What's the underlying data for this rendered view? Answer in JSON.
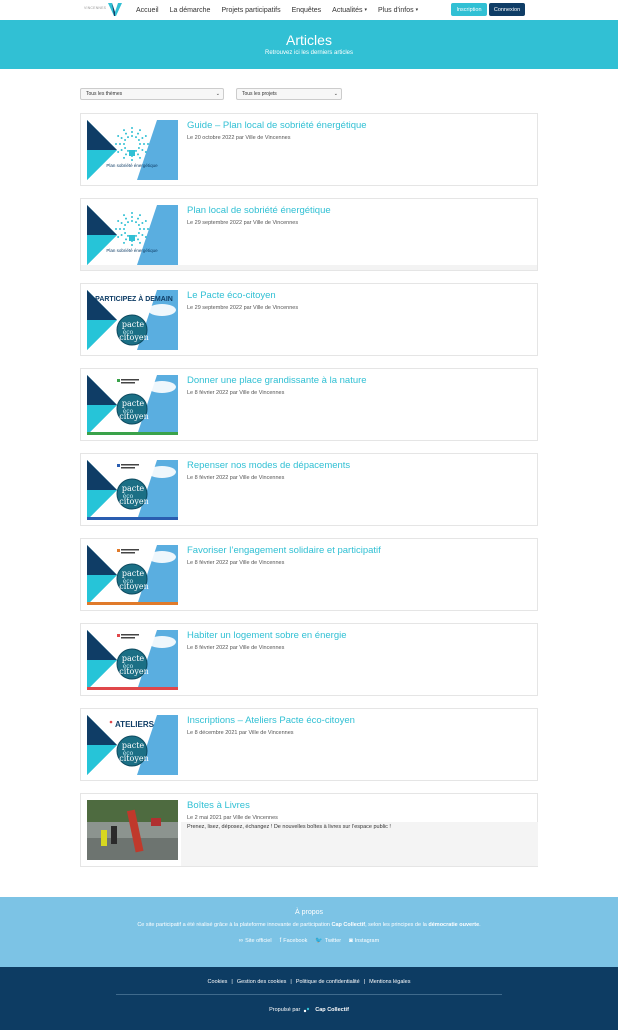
{
  "header": {
    "logo_text": "VINCENNES",
    "nav": [
      {
        "label": "Accueil",
        "caret": false
      },
      {
        "label": "La démarche",
        "caret": false
      },
      {
        "label": "Projets participatifs",
        "caret": false
      },
      {
        "label": "Enquêtes",
        "caret": false
      },
      {
        "label": "Actualités",
        "caret": true
      },
      {
        "label": "Plus d'infos",
        "caret": true
      }
    ],
    "inscription_label": "Inscription",
    "connexion_label": "Connexion"
  },
  "hero": {
    "title": "Articles",
    "subtitle": "Retrouvez ici les derniers articles"
  },
  "filters": {
    "themes": "Tous les thèmes",
    "projects": "Tous les projets"
  },
  "articles": [
    {
      "title": "Guide – Plan local de sobriété énergétique",
      "meta": "Le 20 octobre 2022 par Ville de Vincennes",
      "thumb": "sobriete",
      "thumb_text": "Plan sobriété énergétique"
    },
    {
      "title": "Plan local de sobriété énergétique",
      "meta": "Le 29 septembre 2022 par Ville de Vincennes",
      "thumb": "sobriete",
      "thumb_text": "Plan sobriété énergétique"
    },
    {
      "title": "Le Pacte éco-citoyen",
      "meta": "Le 29 septembre 2022 par Ville de Vincennes",
      "thumb": "participez",
      "thumb_text": "PARTICIPEZ À DEMAIN"
    },
    {
      "title": "Donner une place grandissante à la nature",
      "meta": "Le 8 février 2022 par Ville de Vincennes",
      "thumb": "pacte",
      "thumb_text": "",
      "accent": "#3aa24a"
    },
    {
      "title": "Repenser nos modes de dépacements",
      "meta": "Le 8 février 2022 par Ville de Vincennes",
      "thumb": "pacte",
      "thumb_text": "",
      "accent": "#2a5db0"
    },
    {
      "title": "Favoriser l’engagement solidaire et participatif",
      "meta": "Le 8 février 2022 par Ville de Vincennes",
      "thumb": "pacte",
      "thumb_text": "",
      "accent": "#e07a2a"
    },
    {
      "title": "Habiter un logement sobre en énergie",
      "meta": "Le 8 février 2022 par Ville de Vincennes",
      "thumb": "pacte",
      "thumb_text": "",
      "accent": "#e0474a"
    },
    {
      "title": "Inscriptions – Ateliers Pacte éco-citoyen",
      "meta": "Le 8 décembre 2021 par Ville de Vincennes",
      "thumb": "ateliers",
      "thumb_text": "ATELIERS"
    },
    {
      "title": "Boîtes à Livres",
      "meta": "Le 2 mai 2021 par Ville de Vincennes",
      "thumb": "photo",
      "thumb_text": "",
      "excerpt": "Prenez, lisez, déposez, échangez ! De nouvelles boîtes à livres sur l’espace public !"
    }
  ],
  "pacte_logo": {
    "line1": "pacte",
    "line2": "éco",
    "line3": "citoyen"
  },
  "about": {
    "title": "À propos",
    "text_before": "Ce site participatif a été réalisé grâce à la plateforme innovante de participation ",
    "text_brand": "Cap Collectif",
    "text_middle": ", selon les principes de la ",
    "text_demo": "démocratie ouverte",
    "text_end": ".",
    "links": [
      {
        "icon": "link-icon",
        "glyph": "∞",
        "label": "Site officiel"
      },
      {
        "icon": "facebook-icon",
        "glyph": "f",
        "label": "Facebook"
      },
      {
        "icon": "twitter-icon",
        "glyph": "🐦",
        "label": "Twitter"
      },
      {
        "icon": "instagram-icon",
        "glyph": "◙",
        "label": "Instagram"
      }
    ]
  },
  "footer": {
    "legal": [
      "Cookies",
      "Gestion des cookies",
      "Politique de confidentialité",
      "Mentions légales"
    ],
    "powered_by": "Propulsé par",
    "brand": "Cap Collectif"
  },
  "colors": {
    "accent": "#31c0d4",
    "navy": "#0f3d66",
    "about_bg": "#7cc3e5",
    "footer_bg": "#0d3c63"
  }
}
